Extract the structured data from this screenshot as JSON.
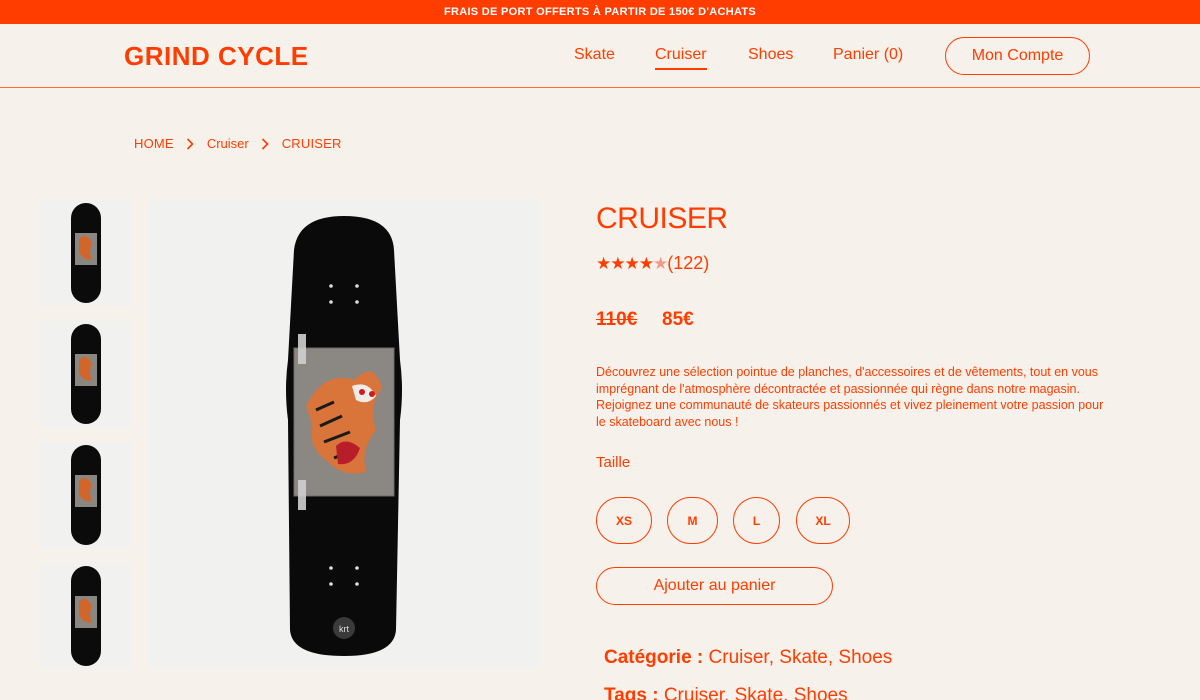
{
  "promo": {
    "text": "FRAIS DE PORT OFFERTS À PARTIR DE 150€ D'ACHATS"
  },
  "header": {
    "logo": "GRIND CYCLE",
    "nav": [
      "Skate",
      "Cruiser",
      "Shoes",
      "Panier (0)"
    ],
    "active_nav": "Cruiser",
    "account_label": "Mon Compte"
  },
  "breadcrumb": {
    "items": [
      "HOME",
      "Cruiser",
      "CRUISER"
    ]
  },
  "product": {
    "title": "CRUISER",
    "rating": {
      "stars": 4,
      "max": 5,
      "count_text": "(122)"
    },
    "old_price": "110€",
    "price": "85€",
    "description": "Découvrez une sélection pointue de planches, d'accessoires et de vêtements, tout en vous imprégnant de l'atmosphère décontractée et passionnée qui règne dans notre magasin. Rejoignez une communauté de skateurs passionnés et vivez pleinement votre passion pour le skateboard avec nous !",
    "size_label": "Taille",
    "sizes": [
      "XS",
      "M",
      "L",
      "XL"
    ],
    "add_to_cart": "Ajouter au panier",
    "category_label": "Catégorie :",
    "category_value": "Cruiser, Skate, Shoes",
    "tags_label": "Tags :",
    "tags_value": "Cruiser, Skate, Shoes"
  },
  "icons": {
    "breadcrumb_separator": "chevron-right-icon"
  },
  "colors": {
    "accent": "#ff3d00",
    "background": "#f6f1ea",
    "image_bg": "#f1f1f0"
  }
}
